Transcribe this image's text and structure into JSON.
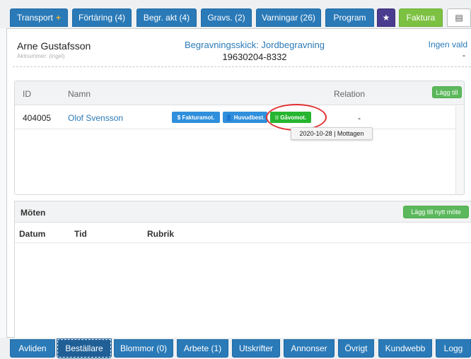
{
  "top_tabs": [
    {
      "label": "Transport",
      "extra": "+"
    },
    {
      "label": "Förtäring (4)"
    },
    {
      "label": "Begr. akt (4)"
    },
    {
      "label": "Gravs. (2)"
    },
    {
      "label": "Varningar (26)"
    },
    {
      "label": "Program"
    },
    {
      "label": "★"
    },
    {
      "label": "Faktura"
    },
    {
      "label": "▤"
    }
  ],
  "header": {
    "name": "Arne Gustafsson",
    "subtext": "Aktnummer: (ingel)",
    "burial_type": "Begravningsskick: Jordbegravning",
    "personal_id": "19630204-8332",
    "selection": "Ingen vald",
    "selection_value": "-"
  },
  "relations": {
    "columns": {
      "id": "ID",
      "name": "Namn",
      "relation": "Relation"
    },
    "add_label": "Lägg till",
    "rows": [
      {
        "id": "404005",
        "name": "Olof Svensson",
        "badges": [
          {
            "label": "$ Fakturamot."
          },
          {
            "label": "👤 Huvudbest."
          },
          {
            "label": "⁝⁝ Gåvomot."
          }
        ],
        "relation": "-"
      }
    ],
    "tooltip": "2020-10-28 | Mottagen"
  },
  "meetings": {
    "title": "Möten",
    "add_label": "Lägg till nytt möte",
    "columns": {
      "date": "Datum",
      "time": "Tid",
      "subject": "Rubrik"
    }
  },
  "bottom_tabs": [
    {
      "label": "Avliden"
    },
    {
      "label": "Beställare"
    },
    {
      "label": "Blommor (0)"
    },
    {
      "label": "Arbete (1)"
    },
    {
      "label": "Utskrifter"
    },
    {
      "label": "Annonser"
    },
    {
      "label": "Övrigt"
    },
    {
      "label": "Kundwebb"
    },
    {
      "label": "Logg"
    }
  ],
  "colors": {
    "tab_blue": "#2a7ab8",
    "tab_purple": "#4a3c8e",
    "tab_green": "#7cc142",
    "badge_blue": "#2f8fdc",
    "badge_green": "#26b530",
    "highlight_ring": "#e03030"
  }
}
